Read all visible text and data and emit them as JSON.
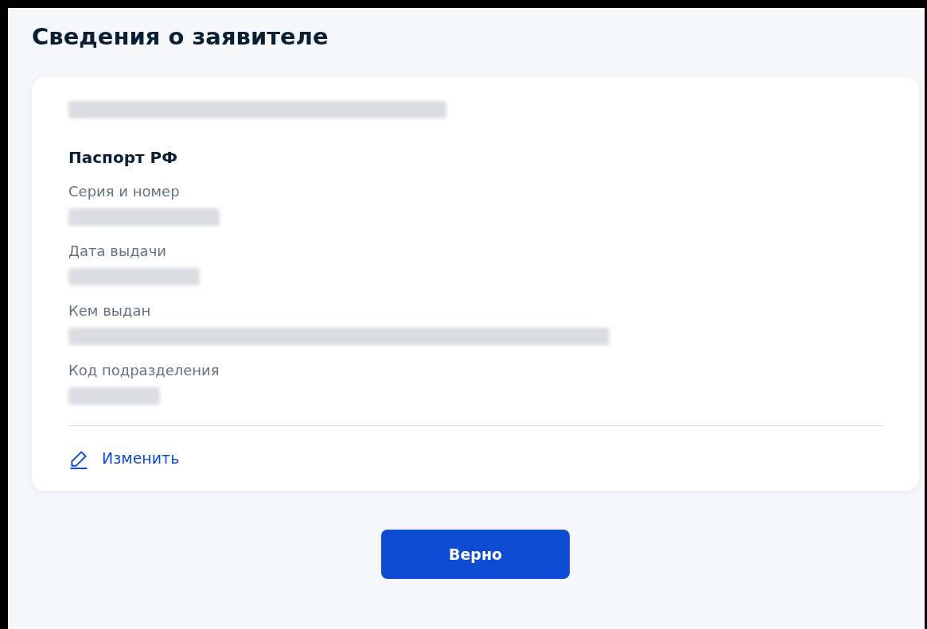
{
  "title": "Сведения о заявителе",
  "card": {
    "document_title": "Паспорт РФ",
    "fields": [
      {
        "label": "Серия и номер"
      },
      {
        "label": "Дата выдачи"
      },
      {
        "label": "Кем выдан"
      },
      {
        "label": "Код подразделения"
      }
    ],
    "edit_link": "Изменить"
  },
  "confirm_button": "Верно"
}
